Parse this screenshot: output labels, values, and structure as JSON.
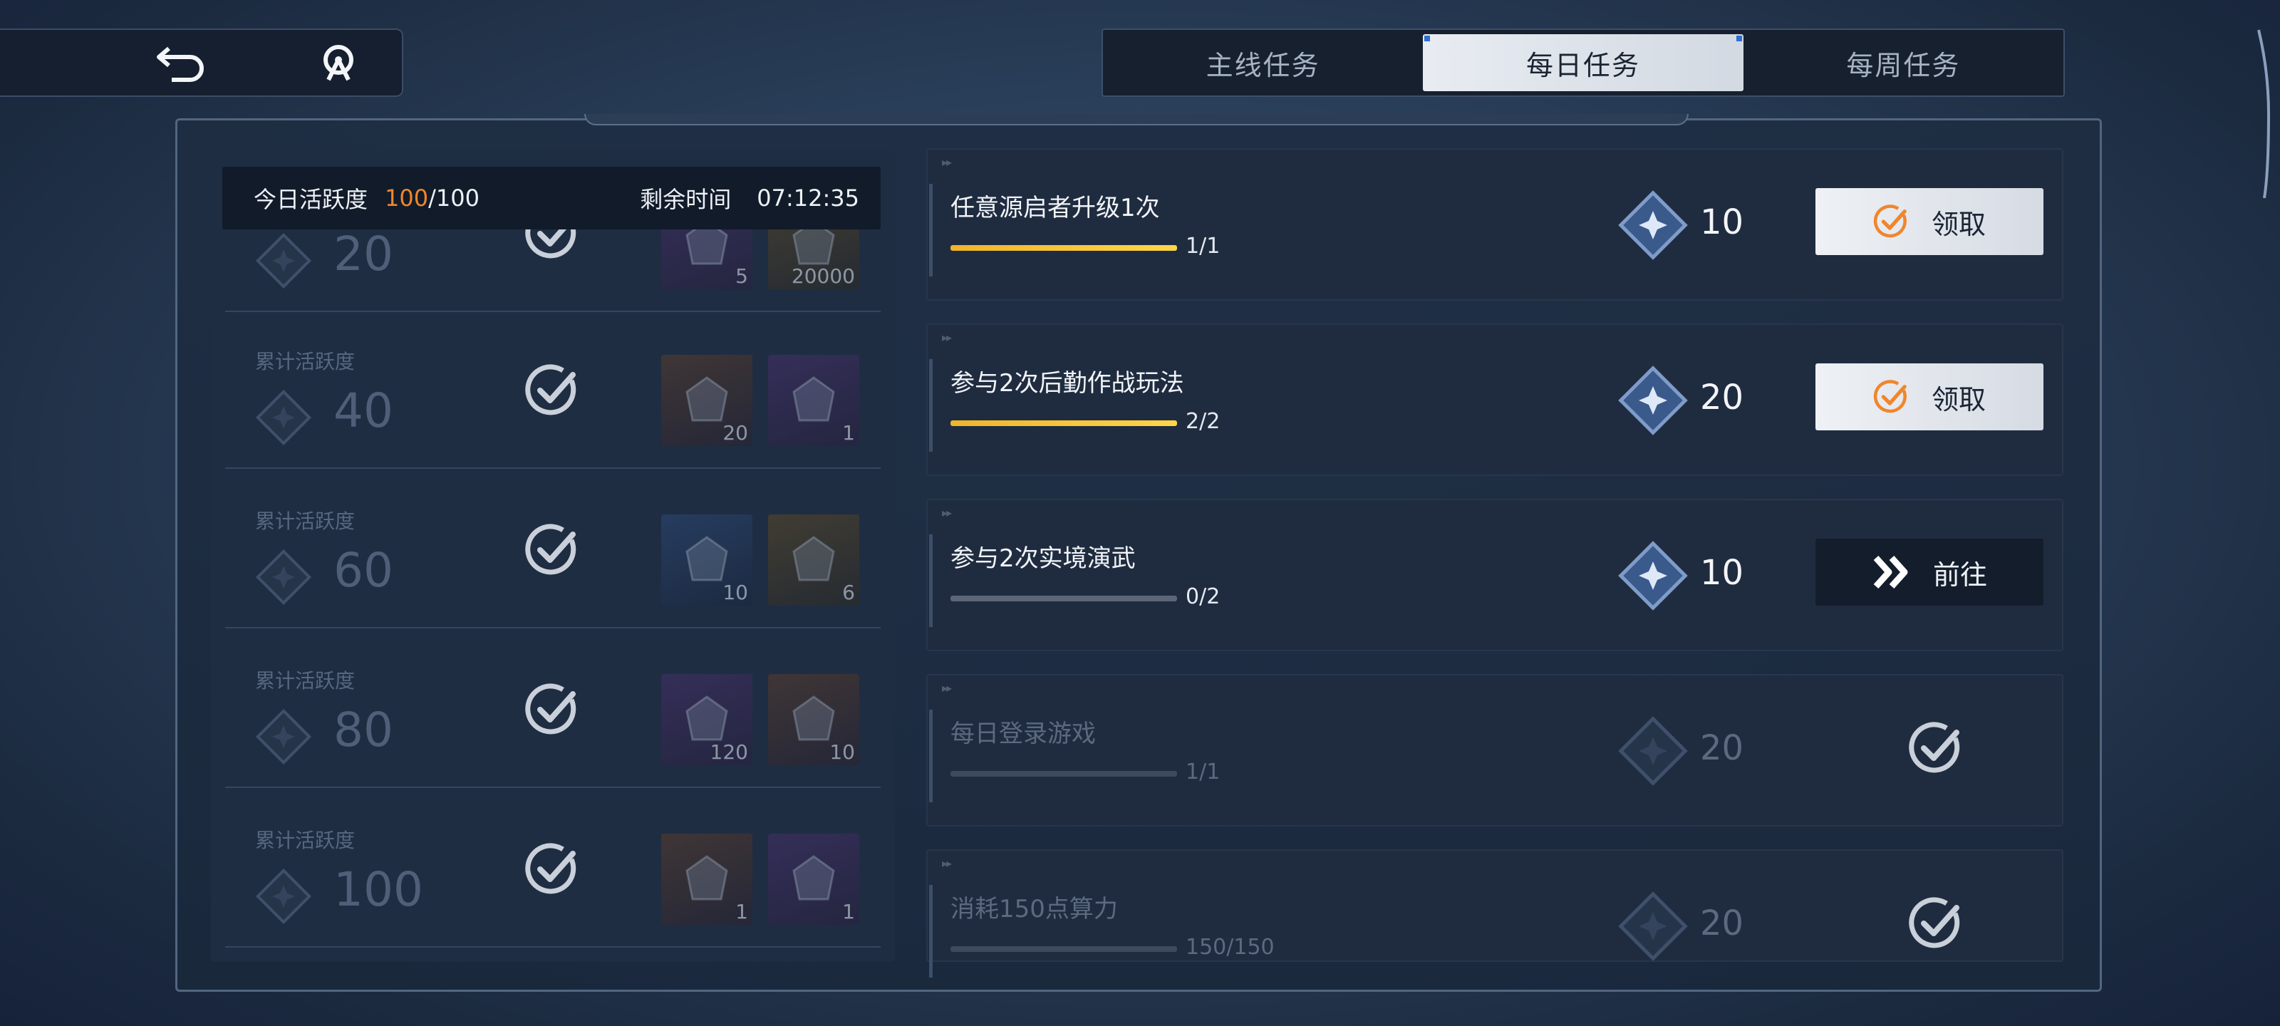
{
  "tabs": [
    {
      "label": "主线任务",
      "active": false
    },
    {
      "label": "每日任务",
      "active": true
    },
    {
      "label": "每周任务",
      "active": false
    }
  ],
  "activity": {
    "label": "今日活跃度",
    "current": "100",
    "max": "/100",
    "remaining_label": "剩余时间",
    "remaining_time": "07:12:35"
  },
  "milestones": [
    {
      "label": "",
      "value": "20",
      "rewards": [
        {
          "count": "5",
          "style": "purple"
        },
        {
          "count": "20000",
          "style": "gold"
        }
      ],
      "claimed": true
    },
    {
      "label": "累计活跃度",
      "value": "40",
      "rewards": [
        {
          "count": "20",
          "style": "orange"
        },
        {
          "count": "1",
          "style": "purple"
        }
      ],
      "claimed": true
    },
    {
      "label": "累计活跃度",
      "value": "60",
      "rewards": [
        {
          "count": "10",
          "style": "blue"
        },
        {
          "count": "6",
          "style": "gold"
        }
      ],
      "claimed": true
    },
    {
      "label": "累计活跃度",
      "value": "80",
      "rewards": [
        {
          "count": "120",
          "style": "purple"
        },
        {
          "count": "10",
          "style": "orange"
        }
      ],
      "claimed": true
    },
    {
      "label": "累计活跃度",
      "value": "100",
      "rewards": [
        {
          "count": "1",
          "style": "orange"
        },
        {
          "count": "1",
          "style": "purple"
        }
      ],
      "claimed": true
    }
  ],
  "tasks": [
    {
      "title": "任意源启者升级1次",
      "progress": "1/1",
      "fraction": 1.0,
      "reward": "10",
      "state": "claim",
      "button": "领取"
    },
    {
      "title": "参与2次后勤作战玩法",
      "progress": "2/2",
      "fraction": 1.0,
      "reward": "20",
      "state": "claim",
      "button": "领取"
    },
    {
      "title": "参与2次实境演武",
      "progress": "0/2",
      "fraction": 0.0,
      "reward": "10",
      "state": "go",
      "button": "前往"
    },
    {
      "title": "每日登录游戏",
      "progress": "1/1",
      "fraction": 1.0,
      "reward": "20",
      "state": "done",
      "button": ""
    },
    {
      "title": "消耗150点算力",
      "progress": "150/150",
      "fraction": 1.0,
      "reward": "20",
      "state": "done",
      "button": ""
    }
  ],
  "icons": {
    "back": "back-arrow-icon",
    "logo": "game-logo-icon",
    "diamond": "activity-diamond-icon",
    "check": "checkmark-circle-icon",
    "go": "double-chevron-icon"
  },
  "colors": {
    "accent_orange": "#f0862c",
    "progress_gold": "#f0b42a",
    "tab_active_bg": "#e8ecf2"
  }
}
